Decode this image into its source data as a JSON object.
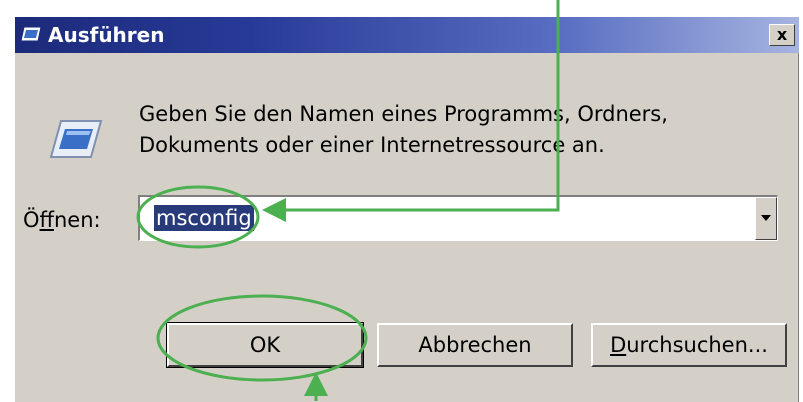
{
  "dialog": {
    "title": "Ausführen",
    "close_label": "x",
    "description_line1": "Geben Sie den Namen eines Programms, Ordners,",
    "description_line2": "Dokuments oder einer Internetressource an.",
    "open_label_first": "Ö",
    "open_label_accel": "f",
    "open_label_rest": "fnen:",
    "open_value": "msconfig",
    "ok_label": "OK",
    "cancel_label": "Abbrechen",
    "browse_label_accel": "D",
    "browse_label_rest": "urchsuchen..."
  },
  "icons": {
    "title_icon": "run-window-icon",
    "dialog_icon": "run-window-icon",
    "dropdown": "chevron-down-icon"
  },
  "colors": {
    "annotation": "#4caf50",
    "title_bar": "#1c2a7a",
    "selection": "#283a7a"
  }
}
